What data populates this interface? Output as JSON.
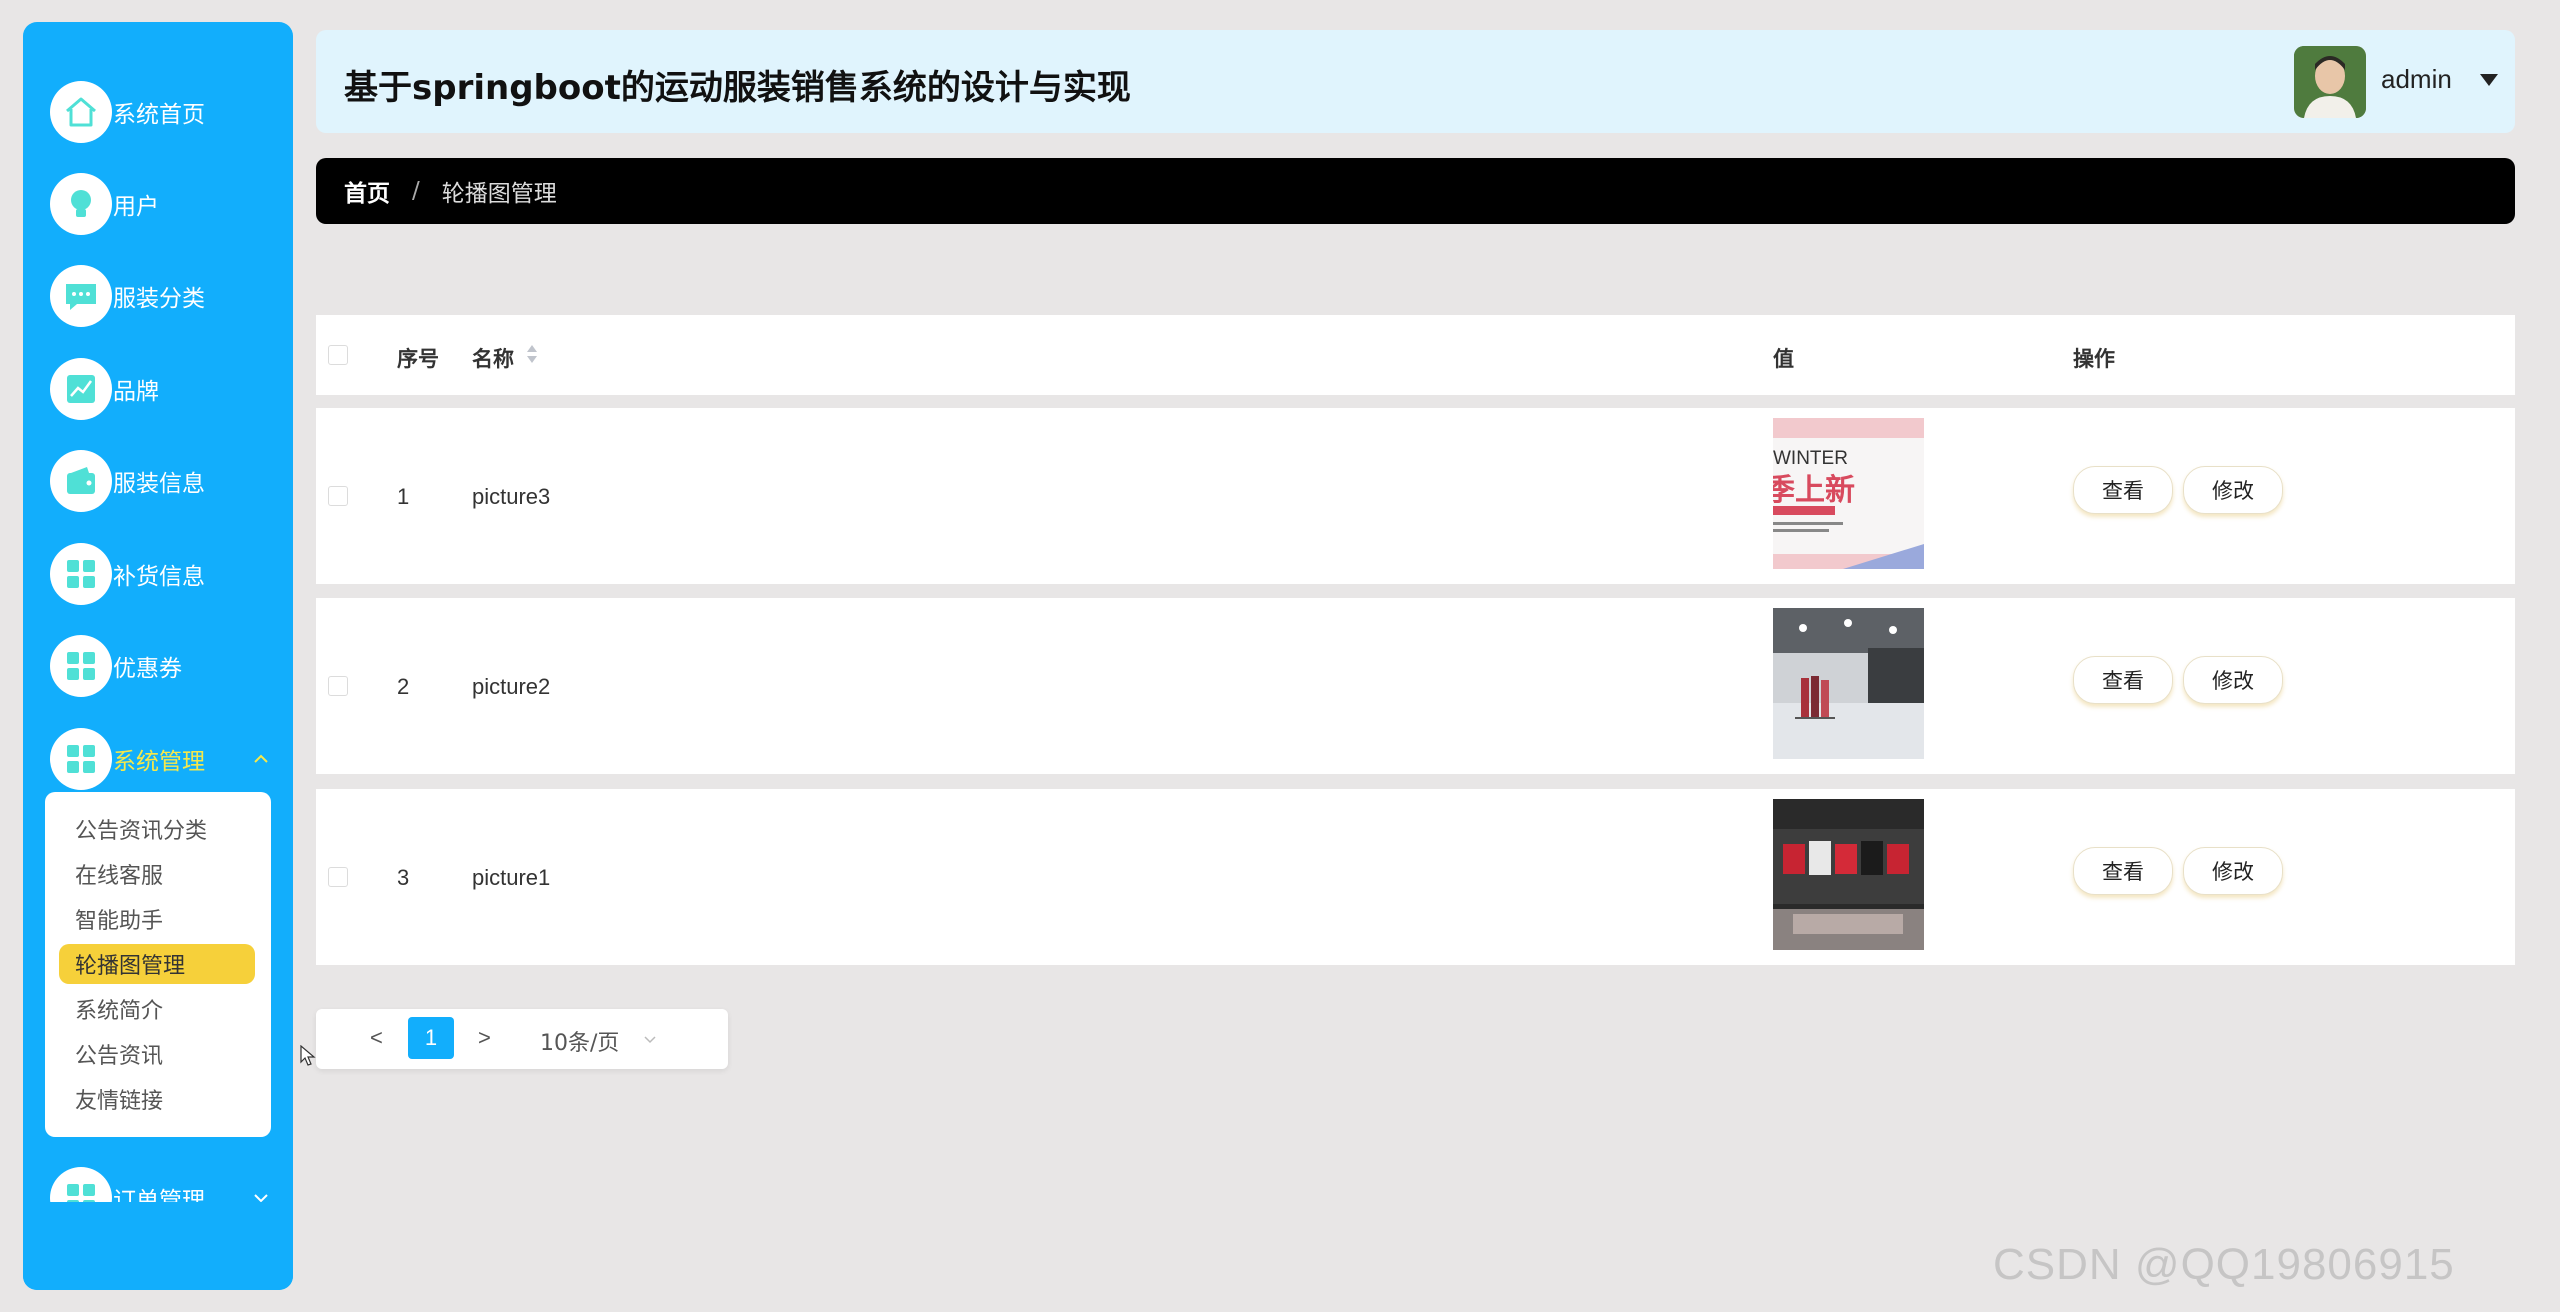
{
  "app": {
    "title": "基于springboot的运动服装销售系统的设计与实现",
    "user": "admin"
  },
  "sidebar": {
    "items": [
      {
        "label": "系统首页",
        "icon": "home-icon"
      },
      {
        "label": "用户",
        "icon": "bulb-icon"
      },
      {
        "label": "服装分类",
        "icon": "chat-icon"
      },
      {
        "label": "品牌",
        "icon": "chart-icon"
      },
      {
        "label": "服装信息",
        "icon": "wallet-icon"
      },
      {
        "label": "补货信息",
        "icon": "grid-icon"
      },
      {
        "label": "优惠券",
        "icon": "grid-icon"
      },
      {
        "label": "系统管理",
        "icon": "grid-icon",
        "expanded": true
      },
      {
        "label": "订单管理",
        "icon": "grid-icon"
      }
    ],
    "submenu": [
      {
        "label": "公告资讯分类"
      },
      {
        "label": "在线客服"
      },
      {
        "label": "智能助手"
      },
      {
        "label": "轮播图管理",
        "active": true
      },
      {
        "label": "系统简介"
      },
      {
        "label": "公告资讯"
      },
      {
        "label": "友情链接"
      }
    ]
  },
  "breadcrumb": {
    "home": "首页",
    "separator": "/",
    "current": "轮播图管理"
  },
  "table": {
    "columns": {
      "index": "序号",
      "name": "名称",
      "value": "值",
      "actions": "操作"
    },
    "rows": [
      {
        "index": "1",
        "name": "picture3",
        "image": "winter-poster"
      },
      {
        "index": "2",
        "name": "picture2",
        "image": "store-interior"
      },
      {
        "index": "3",
        "name": "picture1",
        "image": "clothing-display"
      }
    ],
    "view_label": "查看",
    "edit_label": "修改"
  },
  "poster": {
    "line1": "WINTER",
    "line2": "季上新"
  },
  "pagination": {
    "prev": "<",
    "current_page": "1",
    "next": ">",
    "page_size": "10条/页"
  },
  "watermark": "CSDN @QQ19806915",
  "colors": {
    "sidebar": "#12aefc",
    "icon_teal": "#4fe0d6",
    "active_menu_text": "#f6e84a",
    "active_submenu": "#f6d03a",
    "header_bg": "#e0f4fd",
    "breadcrumb_bg": "#000000"
  }
}
